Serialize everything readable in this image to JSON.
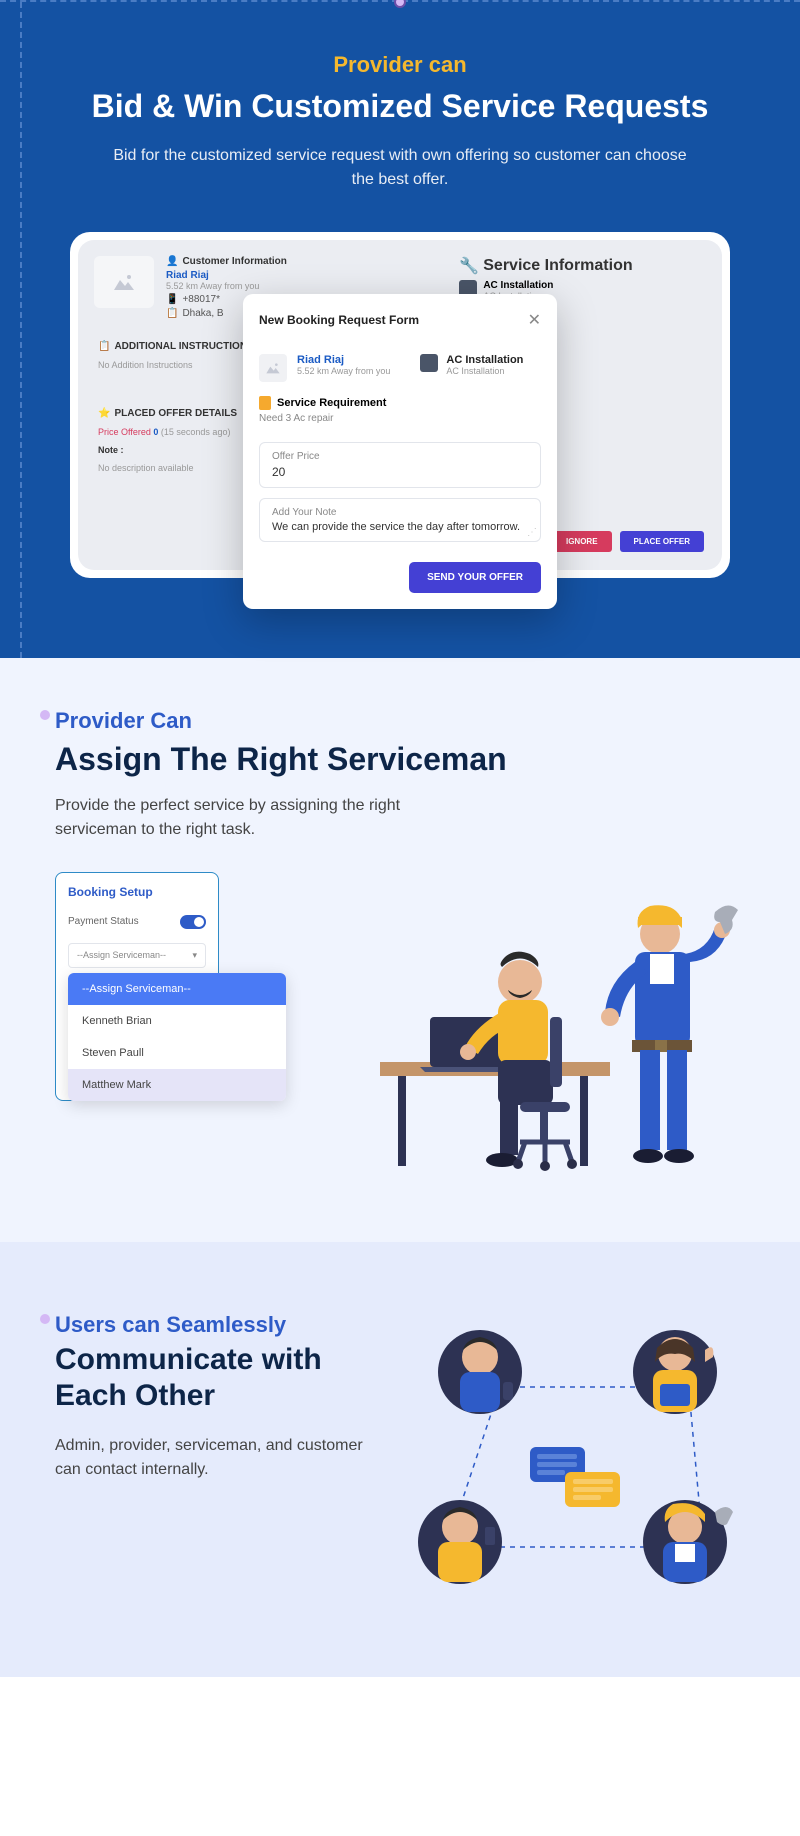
{
  "section1": {
    "eyebrow": "Provider can",
    "title": "Bid & Win Customized Service Requests",
    "desc": "Bid for the customized service request with own offering so customer can choose the best offer.",
    "bg": {
      "customer_header": "Customer Information",
      "customer_name": "Riad Riaj",
      "customer_distance": "5.52 km Away from you",
      "customer_phone": "+88017*",
      "customer_loc": "Dhaka, B",
      "service_header": "Service Information",
      "service_name": "AC Installation",
      "service_sub": "AC Installation",
      "add_instr_header": "ADDITIONAL INSTRUCTION",
      "add_instr_body": "No Addition Instructions",
      "offer_header": "PLACED OFFER DETAILS",
      "offer_label": "Price Offered",
      "offer_count": "0",
      "offer_ago": "(15 seconds ago)",
      "note_label": "Note :",
      "note_body": "No description available",
      "btn_ignore": "IGNORE",
      "btn_place": "PLACE OFFER"
    },
    "modal": {
      "title": "New Booking Request Form",
      "customer_name": "Riad Riaj",
      "customer_distance": "5.52 km Away from you",
      "service_name": "AC Installation",
      "service_sub": "AC Installation",
      "sr_label": "Service Requirement",
      "sr_text": "Need 3 Ac repair",
      "offer_label": "Offer Price",
      "offer_value": "20",
      "note_label": "Add Your Note",
      "note_value": "We can provide the service the day after tomorrow.",
      "btn_send": "SEND YOUR OFFER"
    }
  },
  "section2": {
    "eyebrow": "Provider Can",
    "title": "Assign The Right Serviceman",
    "desc": "Provide the perfect service by assigning the right serviceman to the right task.",
    "booking": {
      "title": "Booking Setup",
      "payment_label": "Payment Status",
      "select_placeholder": "--Assign Serviceman--",
      "options": [
        "--Assign Serviceman--",
        "Kenneth Brian",
        "Steven Paull",
        "Matthew Mark"
      ]
    }
  },
  "section3": {
    "eyebrow": "Users can Seamlessly",
    "title": "Communicate with Each Other",
    "desc": "Admin, provider, serviceman, and customer can contact internally."
  }
}
